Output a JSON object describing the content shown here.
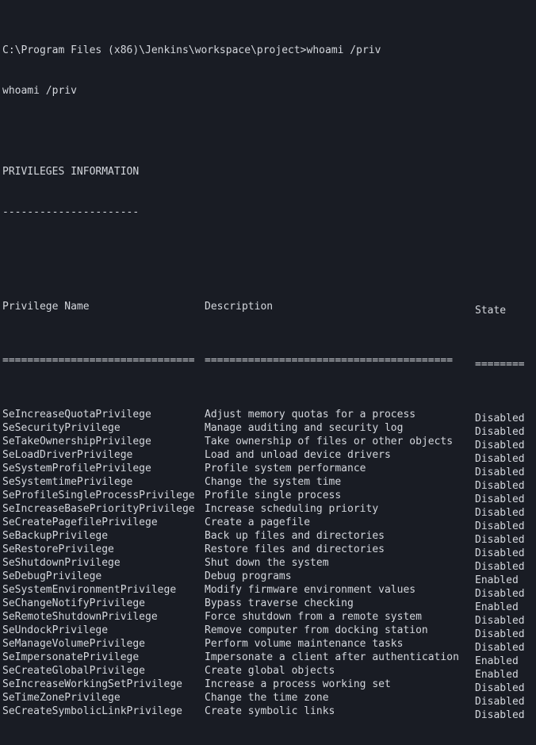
{
  "terminal": {
    "colors": {
      "background": "#191c24",
      "foreground": "#d4d7dd"
    },
    "prompt_line": "C:\\Program Files (x86)\\Jenkins\\workspace\\project>whoami /priv",
    "echoed_command": "whoami /priv",
    "section_title": "PRIVILEGES INFORMATION",
    "section_rule": "----------------------",
    "table": {
      "headers": {
        "name": "Privilege Name",
        "description": "Description",
        "state": "State"
      },
      "header_rules": {
        "name": "===============================",
        "description": "========================================",
        "state": "========"
      },
      "rows": [
        {
          "name": "SeIncreaseQuotaPrivilege",
          "description": "Adjust memory quotas for a process",
          "state": "Disabled"
        },
        {
          "name": "SeSecurityPrivilege",
          "description": "Manage auditing and security log",
          "state": "Disabled"
        },
        {
          "name": "SeTakeOwnershipPrivilege",
          "description": "Take ownership of files or other objects",
          "state": "Disabled"
        },
        {
          "name": "SeLoadDriverPrivilege",
          "description": "Load and unload device drivers",
          "state": "Disabled"
        },
        {
          "name": "SeSystemProfilePrivilege",
          "description": "Profile system performance",
          "state": "Disabled"
        },
        {
          "name": "SeSystemtimePrivilege",
          "description": "Change the system time",
          "state": "Disabled"
        },
        {
          "name": "SeProfileSingleProcessPrivilege",
          "description": "Profile single process",
          "state": "Disabled"
        },
        {
          "name": "SeIncreaseBasePriorityPrivilege",
          "description": "Increase scheduling priority",
          "state": "Disabled"
        },
        {
          "name": "SeCreatePagefilePrivilege",
          "description": "Create a pagefile",
          "state": "Disabled"
        },
        {
          "name": "SeBackupPrivilege",
          "description": "Back up files and directories",
          "state": "Disabled"
        },
        {
          "name": "SeRestorePrivilege",
          "description": "Restore files and directories",
          "state": "Disabled"
        },
        {
          "name": "SeShutdownPrivilege",
          "description": "Shut down the system",
          "state": "Disabled"
        },
        {
          "name": "SeDebugPrivilege",
          "description": "Debug programs",
          "state": "Enabled"
        },
        {
          "name": "SeSystemEnvironmentPrivilege",
          "description": "Modify firmware environment values",
          "state": "Disabled"
        },
        {
          "name": "SeChangeNotifyPrivilege",
          "description": "Bypass traverse checking",
          "state": "Enabled"
        },
        {
          "name": "SeRemoteShutdownPrivilege",
          "description": "Force shutdown from a remote system",
          "state": "Disabled"
        },
        {
          "name": "SeUndockPrivilege",
          "description": "Remove computer from docking station",
          "state": "Disabled"
        },
        {
          "name": "SeManageVolumePrivilege",
          "description": "Perform volume maintenance tasks",
          "state": "Disabled"
        },
        {
          "name": "SeImpersonatePrivilege",
          "description": "Impersonate a client after authentication",
          "state": "Enabled"
        },
        {
          "name": "SeCreateGlobalPrivilege",
          "description": "Create global objects",
          "state": "Enabled"
        },
        {
          "name": "SeIncreaseWorkingSetPrivilege",
          "description": "Increase a process working set",
          "state": "Disabled"
        },
        {
          "name": "SeTimeZonePrivilege",
          "description": "Change the time zone",
          "state": "Disabled"
        },
        {
          "name": "SeCreateSymbolicLinkPrivilege",
          "description": "Create symbolic links",
          "state": "Disabled"
        }
      ]
    }
  }
}
